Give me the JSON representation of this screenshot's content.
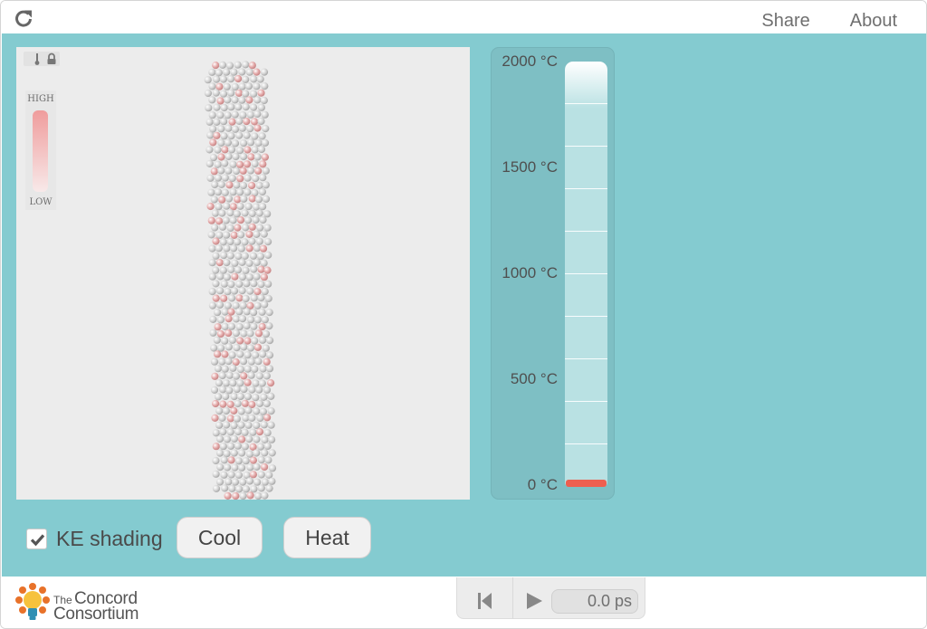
{
  "topbar": {
    "reload_icon": "reload-icon",
    "share_label": "Share",
    "about_label": "About"
  },
  "model": {
    "legend": {
      "high_label": "HIGH",
      "low_label": "LOW"
    },
    "colors": {
      "atom": "#d0d0d0",
      "hot_atom": "#e39a9a",
      "background": "#ececec"
    }
  },
  "thermometer": {
    "ticks": [
      "2000 °C",
      "1500 °C",
      "1000 °C",
      "500 °C",
      "0 °C"
    ],
    "level_fraction": 0.0,
    "mercury_color": "#ee5f50"
  },
  "controls": {
    "ke_shading_label": "KE shading",
    "ke_shading_checked": true,
    "cool_label": "Cool",
    "heat_label": "Heat"
  },
  "footer": {
    "logo_the": "The",
    "logo_line1": "Concord",
    "logo_line2": "Consortium",
    "time_value": "0.0 ps"
  },
  "colors": {
    "stage": "#84cbd0",
    "thermo_bg": "#7ebfc4"
  }
}
